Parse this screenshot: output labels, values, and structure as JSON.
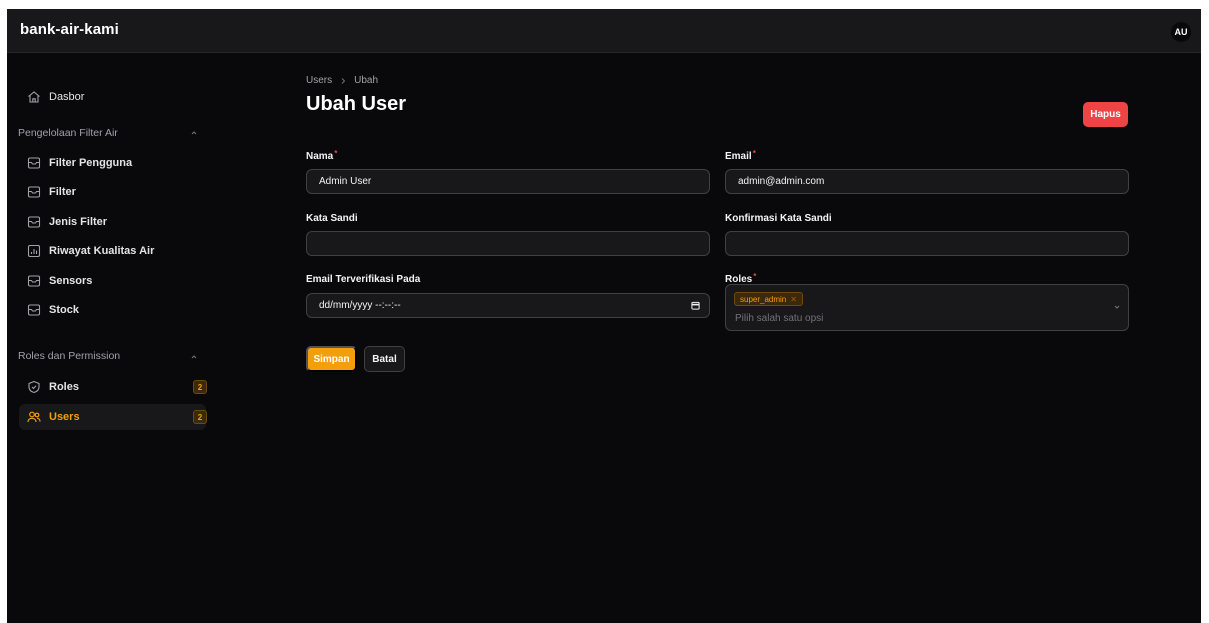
{
  "app": {
    "brand": "bank-air-kami",
    "avatar_initials": "AU"
  },
  "sidebar": {
    "dashboard": {
      "label": "Dasbor",
      "icon": "home-icon"
    },
    "groups": [
      {
        "label": "Pengelolaan Filter Air",
        "items": [
          {
            "label": "Filter Pengguna",
            "icon": "inbox-icon"
          },
          {
            "label": "Filter",
            "icon": "inbox-icon"
          },
          {
            "label": "Jenis Filter",
            "icon": "inbox-icon"
          },
          {
            "label": "Riwayat Kualitas Air",
            "icon": "chart-bar-icon"
          },
          {
            "label": "Sensors",
            "icon": "inbox-icon"
          },
          {
            "label": "Stock",
            "icon": "inbox-icon"
          }
        ]
      },
      {
        "label": "Roles dan Permission",
        "items": [
          {
            "label": "Roles",
            "icon": "shield-check-icon",
            "badge": "2"
          },
          {
            "label": "Users",
            "icon": "users-icon",
            "badge": "2",
            "active": true
          }
        ]
      }
    ]
  },
  "breadcrumb": {
    "parent": "Users",
    "current": "Ubah"
  },
  "page": {
    "title": "Ubah User",
    "delete_label": "Hapus"
  },
  "form": {
    "nama": {
      "label": "Nama",
      "required": "*",
      "value": "Admin User"
    },
    "email": {
      "label": "Email",
      "required": "*",
      "value": "admin@admin.com"
    },
    "password": {
      "label": "Kata Sandi",
      "value": ""
    },
    "password_confirm": {
      "label": "Konfirmasi Kata Sandi",
      "value": ""
    },
    "verified_at": {
      "label": "Email Terverifikasi Pada",
      "value": "dd/mm/yyyy --:--:--"
    },
    "roles": {
      "label": "Roles",
      "required": "*",
      "selected": [
        "super_admin"
      ],
      "placeholder": "Pilih salah satu opsi"
    }
  },
  "actions": {
    "save_label": "Simpan",
    "cancel_label": "Batal"
  },
  "colors": {
    "accent": "#f59e0b",
    "danger": "#ef4444",
    "background": "#09090b",
    "surface": "#18181b"
  }
}
